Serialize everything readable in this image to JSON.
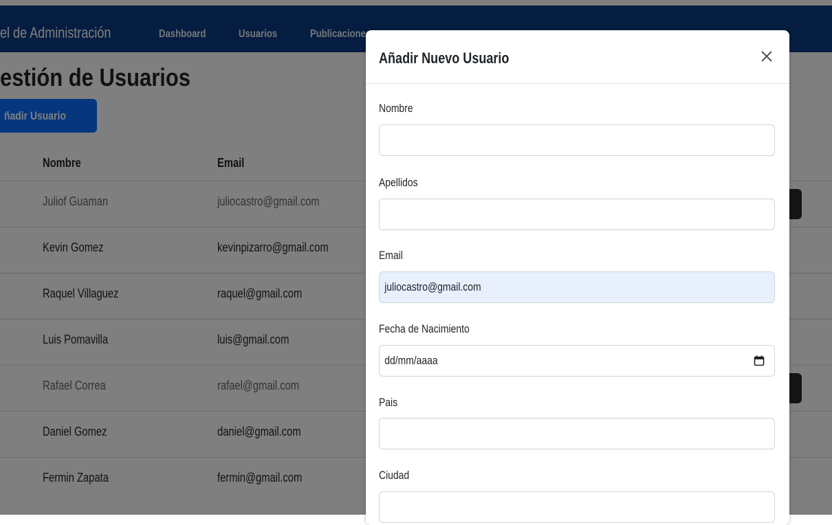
{
  "navbar": {
    "brand": "el de Administración",
    "links": [
      "Dashboard",
      "Usuarios",
      "Publicaciones"
    ]
  },
  "page": {
    "title": "estión de Usuarios",
    "add_button": "ñadir Usuario"
  },
  "table": {
    "headers": [
      "Nombre",
      "Email"
    ],
    "rows": [
      {
        "name": "Juliof Guaman",
        "email": "juliocastro@gmail.com"
      },
      {
        "name": "Kevin Gomez",
        "email": "kevinpizarro@gmail.com"
      },
      {
        "name": "Raquel Villaguez",
        "email": "raquel@gmail.com"
      },
      {
        "name": "Luis Pomavilla",
        "email": "luis@gmail.com"
      },
      {
        "name": "Rafael Correa",
        "email": "rafael@gmail.com"
      },
      {
        "name": "Daniel Gomez",
        "email": "daniel@gmail.com"
      },
      {
        "name": "Fermin Zapata",
        "email": "fermin@gmail.com"
      }
    ]
  },
  "modal": {
    "title": "Añadir Nuevo Usuario",
    "fields": [
      {
        "label": "Nombre",
        "value": ""
      },
      {
        "label": "Apellidos",
        "value": ""
      },
      {
        "label": "Email",
        "value": "juliocastro@gmail.com"
      },
      {
        "label": "Fecha de Nacimiento",
        "value": "dd/mm/aaaa"
      },
      {
        "label": "Pais",
        "value": ""
      },
      {
        "label": "Ciudad",
        "value": ""
      }
    ]
  },
  "icons": {
    "close": "close-icon",
    "calendar": "calendar-icon"
  },
  "colors": {
    "navbar": "#0b3a82",
    "primary_button": "#0d6efd",
    "autofill": "#e8f0fe"
  }
}
